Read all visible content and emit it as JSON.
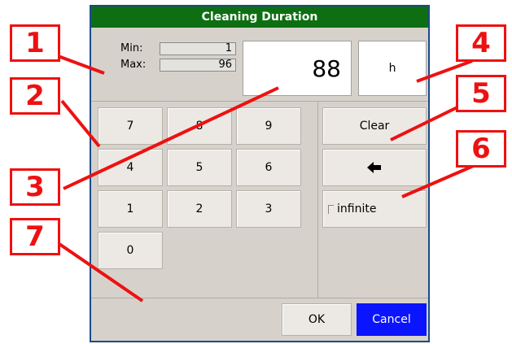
{
  "dialog": {
    "title": "Cleaning Duration",
    "min_label": "Min:",
    "min_value": "1",
    "max_label": "Max:",
    "max_value": "96",
    "value": "88",
    "unit": "h"
  },
  "keypad": {
    "k7": "7",
    "k8": "8",
    "k9": "9",
    "k4": "4",
    "k5": "5",
    "k6": "6",
    "k1": "1",
    "k2": "2",
    "k3": "3",
    "k0": "0"
  },
  "side": {
    "clear": "Clear",
    "infinite": "infinite",
    "backspace_icon": "arrow-left-icon"
  },
  "footer": {
    "ok": "OK",
    "cancel": "Cancel",
    "cancel_color": "#0a14ff"
  },
  "callouts": [
    "1",
    "2",
    "3",
    "4",
    "5",
    "6",
    "7"
  ],
  "callout_color": "#ee1111"
}
